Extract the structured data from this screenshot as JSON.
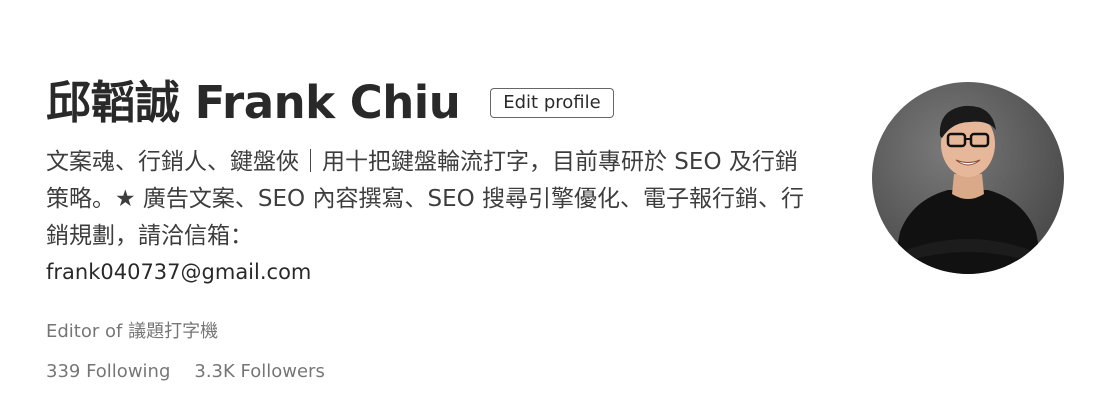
{
  "profile": {
    "name": "邱韜誠 Frank Chiu",
    "edit_label": "Edit profile",
    "bio": "文案魂、行銷人、鍵盤俠｜用十把鍵盤輪流打字，目前專研於 SEO 及行銷策略。★ 廣告文案、SEO 內容撰寫、SEO 搜尋引擎優化、電子報行銷、行銷規劃，請洽信箱：",
    "email": "frank040737@gmail.com",
    "editor_prefix": "Editor of",
    "publication": "議題打字機",
    "following": "339 Following",
    "followers": "3.3K Followers"
  },
  "icons": {
    "avatar": "profile-photo"
  }
}
